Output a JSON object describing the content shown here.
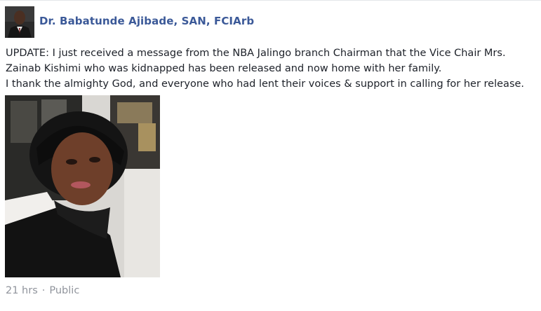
{
  "post": {
    "author_name": "Dr.  Babatunde  Ajibade,  SAN,  FCIArb",
    "text_lines": [
      "UPDATE:  I just received  a  message  from  the  NBA  Jalingo  branch  Chairman  that  the  Vice  Chair  Mrs.",
      "Zainab  Kishimi  who  was  kidnapped  has  been  released  and  now  home  with  her  family.",
      "I  thank  the  almighty  God,  and  everyone  who  had  lent  their  voices &  support  in  calling  for  her  release."
    ],
    "timestamp": "21 hrs",
    "separator": "·",
    "audience": "Public"
  },
  "colors": {
    "author_link": "#3b5998",
    "body_text": "#1d2129",
    "meta_text": "#90949c"
  }
}
